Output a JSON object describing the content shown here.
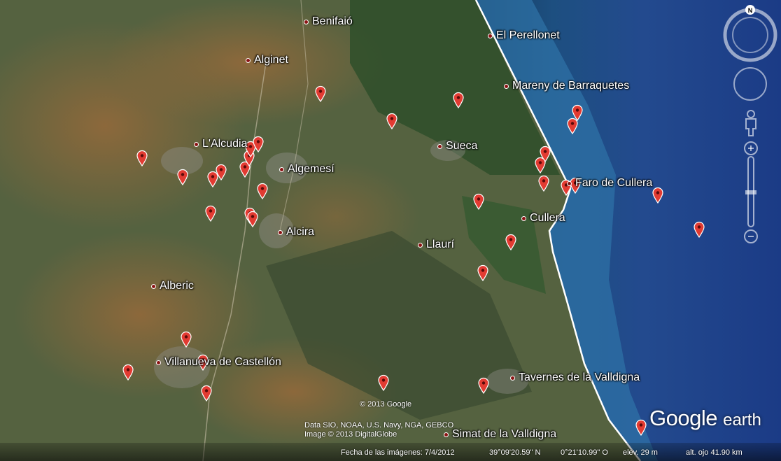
{
  "app": {
    "name": "Google Earth"
  },
  "colors": {
    "pin": "#e23b32",
    "town_dot": "#8a1313",
    "coast": "#ffffff",
    "sea_deep": "#1e3e86",
    "sea_shallow": "#2f6fa8"
  },
  "towns": [
    {
      "name": "Benifaió"
    },
    {
      "name": "El Perellonet"
    },
    {
      "name": "Alginet"
    },
    {
      "name": "Mareny de Barraquetes"
    },
    {
      "name": "L'Alcudia"
    },
    {
      "name": "Sueca"
    },
    {
      "name": "Algemesí"
    },
    {
      "name": "Faro de Cullera"
    },
    {
      "name": "Cullera"
    },
    {
      "name": "Alcira"
    },
    {
      "name": "Llaurí"
    },
    {
      "name": "Alberic"
    },
    {
      "name": "Villanueva de Castellón"
    },
    {
      "name": "Tavernes de la Valldigna"
    },
    {
      "name": "Simat de la Valldigna"
    }
  ],
  "attribution": {
    "copyright": "© 2013 Google",
    "data": "Data SIO, NOAA, U.S. Navy, NGA, GEBCO",
    "image": "Image © 2013 DigitalGlobe"
  },
  "status": {
    "image_date": "Fecha de las imágenes: 7/4/2012",
    "lat": "39°09'20.59\" N",
    "lon": "0°21'10.99\" O",
    "elev": "elev.   29 m",
    "eye_alt": "alt. ojo   41.90 km"
  },
  "logo": {
    "brand": "Google",
    "product": "earth"
  },
  "controls": {
    "north_label": "N",
    "icons": [
      "compass-icon",
      "look-joystick-icon",
      "pegman-icon",
      "zoom-slider-icon"
    ]
  }
}
